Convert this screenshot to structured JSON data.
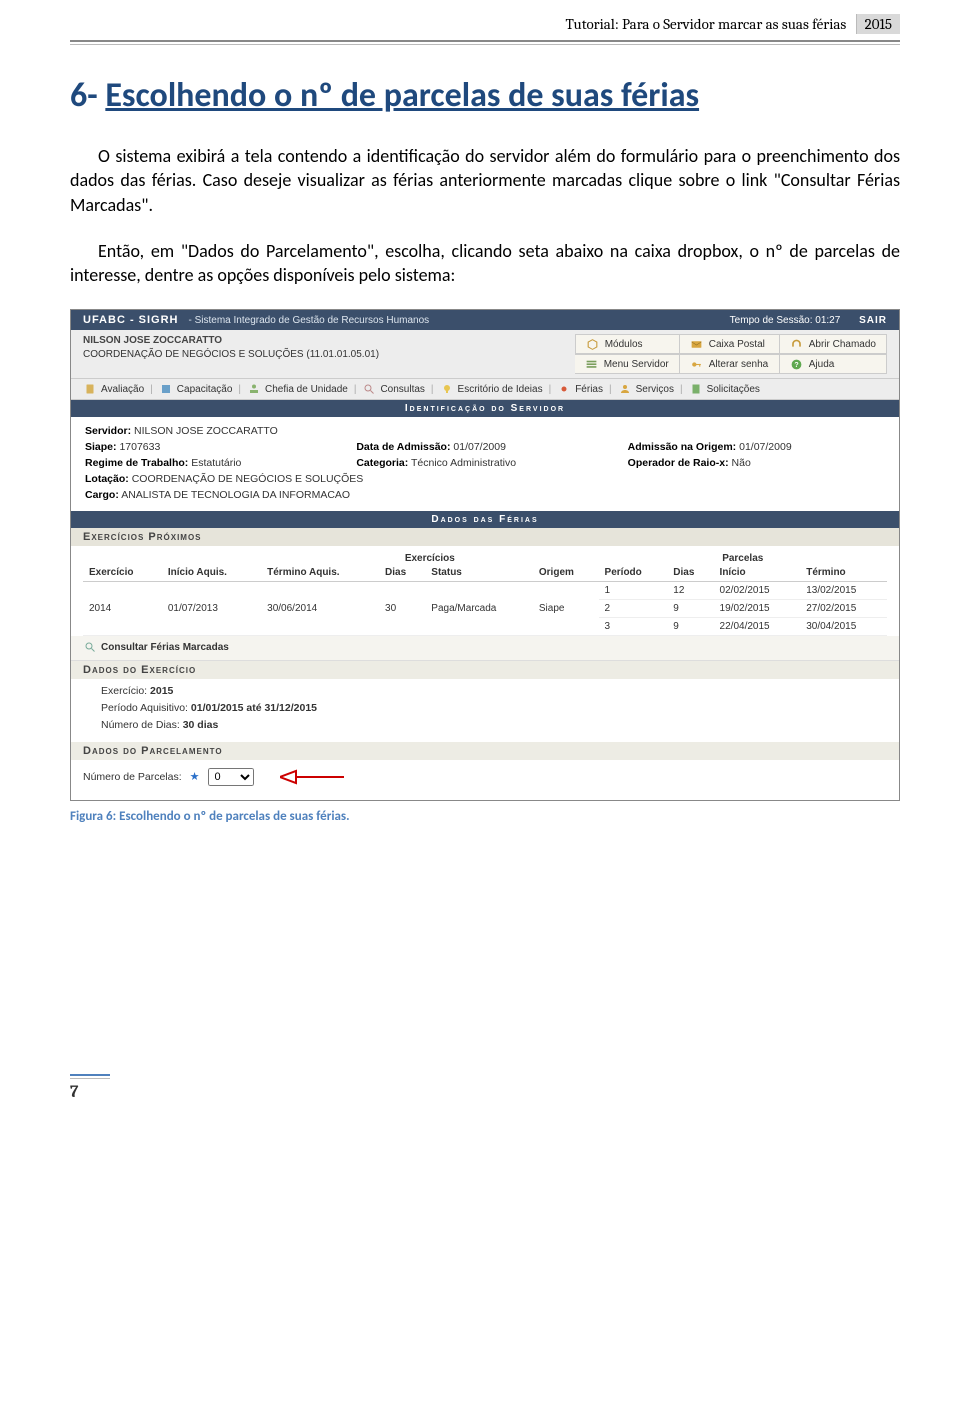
{
  "doc": {
    "header_title": "Tutorial: Para o Servidor marcar as suas férias",
    "year": "2015",
    "section_num": "6-",
    "section_title": "Escolhendo o nº de parcelas de suas férias",
    "para1": "O sistema exibirá a tela contendo a identificação do servidor além do formulário para o preenchimento dos dados das férias. Caso deseje visualizar as férias anteriormente marcadas  clique sobre o link \"Consultar Férias Marcadas\".",
    "para2": "Então, em \"Dados do Parcelamento\", escolha, clicando seta abaixo na caixa dropbox, o nº de parcelas  de interesse, dentre as opções disponíveis pelo sistema:",
    "caption": "Figura 6: Escolhendo o nº de parcelas de suas férias.",
    "pagenum": "7"
  },
  "sys": {
    "brand": "UFABC - SIGRH",
    "subtitle": "- Sistema Integrado de Gestão de Recursos Humanos",
    "session_label": "Tempo de Sessão: 01:27",
    "sair": "SAIR",
    "user_name": "NILSON JOSE ZOCCARATTO",
    "user_unit": "COORDENAÇÃO DE NEGÓCIOS E SOLUÇÕES (11.01.01.05.01)",
    "top_links": [
      {
        "icon": "cube",
        "label": "Módulos"
      },
      {
        "icon": "mail",
        "label": "Caixa Postal"
      },
      {
        "icon": "headset",
        "label": "Abrir Chamado"
      },
      {
        "icon": "menu",
        "label": "Menu Servidor"
      },
      {
        "icon": "key",
        "label": "Alterar senha"
      },
      {
        "icon": "help",
        "label": "Ajuda"
      }
    ],
    "nav": [
      "Avaliação",
      "Capacitação",
      "Chefia de Unidade",
      "Consultas",
      "Escritório de Ideias",
      "Férias",
      "Serviços",
      "Solicitações"
    ]
  },
  "ident": {
    "band": "Identificação do Servidor",
    "servidor_label": "Servidor:",
    "servidor": "NILSON JOSE ZOCCARATTO",
    "siape_label": "Siape:",
    "siape": "1707633",
    "adm_label": "Data de Admissão:",
    "adm": "01/07/2009",
    "adm_orig_label": "Admissão na Origem:",
    "adm_orig": "01/07/2009",
    "regime_label": "Regime de Trabalho:",
    "regime": "Estatutário",
    "cat_label": "Categoria:",
    "cat": "Técnico Administrativo",
    "raiox_label": "Operador de Raio-x:",
    "raiox": "Não",
    "lot_label": "Lotação:",
    "lot": "COORDENAÇÃO DE NEGÓCIOS E SOLUÇÕES",
    "cargo_label": "Cargo:",
    "cargo": "ANALISTA DE TECNOLOGIA DA INFORMACAO"
  },
  "ferias": {
    "band": "Dados das Férias",
    "proximos": "Exercícios Próximos",
    "group_exerc": "Exercícios",
    "group_parc": "Parcelas",
    "cols": {
      "exercicio": "Exercício",
      "inicio_aq": "Início Aquis.",
      "termino_aq": "Término Aquis.",
      "dias": "Dias",
      "status": "Status",
      "origem": "Origem",
      "periodo": "Período",
      "dias2": "Dias",
      "inicio": "Início",
      "termino": "Término"
    },
    "base": {
      "exercicio": "2014",
      "inicio_aq": "01/07/2013",
      "termino_aq": "30/06/2014",
      "dias": "30",
      "status": "Paga/Marcada",
      "origem": "Siape"
    },
    "parcelas": [
      {
        "periodo": "1",
        "dias": "12",
        "inicio": "02/02/2015",
        "termino": "13/02/2015"
      },
      {
        "periodo": "2",
        "dias": "9",
        "inicio": "19/02/2015",
        "termino": "27/02/2015"
      },
      {
        "periodo": "3",
        "dias": "9",
        "inicio": "22/04/2015",
        "termino": "30/04/2015"
      }
    ],
    "consult_link": "Consultar Férias Marcadas"
  },
  "exerc": {
    "band": "Dados do Exercício",
    "exerc_label": "Exercício:",
    "exerc": "2015",
    "periodo_label": "Período Aquisitivo:",
    "periodo": "01/01/2015 até 31/12/2015",
    "dias_label": "Número de Dias:",
    "dias": "30 dias"
  },
  "parc": {
    "band": "Dados do Parcelamento",
    "label": "Número de Parcelas:",
    "value": "0"
  }
}
